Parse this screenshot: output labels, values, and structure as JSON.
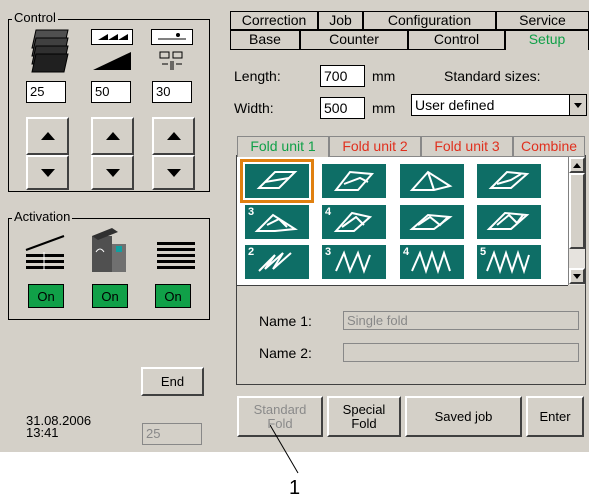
{
  "left": {
    "control_title": "Control",
    "values": [
      "25",
      "50",
      "30"
    ],
    "activation_title": "Activation",
    "on_labels": [
      "On",
      "On",
      "On"
    ],
    "end_label": "End",
    "date": "31.08.2006",
    "time": "13:41",
    "counter_value": "25"
  },
  "tabs": {
    "row1": [
      "Correction",
      "Job",
      "Configuration",
      "Service"
    ],
    "row2": [
      "Base",
      "Counter",
      "Control",
      "Setup"
    ],
    "active": "Setup",
    "active_color": "#10a048"
  },
  "sizes": {
    "length_label": "Length:",
    "length_value": "700",
    "width_label": "Width:",
    "width_value": "500",
    "unit": "mm",
    "standard_label": "Standard sizes:",
    "selected": "User defined"
  },
  "fold_tabs": {
    "items": [
      "Fold unit 1",
      "Fold unit 2",
      "Fold unit 3",
      "Combine"
    ],
    "active_color": "#10a048",
    "inactive_color": "#e0301e"
  },
  "fold_grid": {
    "badges": [
      "",
      "",
      "",
      "",
      "3",
      "4",
      "",
      "",
      "2",
      "3",
      "4",
      "5"
    ],
    "selected_index": 0,
    "tile_color": "#0e6e66",
    "selected_border": "#e08010"
  },
  "names": {
    "name1_label": "Name 1:",
    "name1_value": "Single fold",
    "name2_label": "Name 2:",
    "name2_value": ""
  },
  "bottom_buttons": {
    "standard_fold": [
      "Standard",
      "Fold"
    ],
    "special_fold": [
      "Special",
      "Fold"
    ],
    "saved_job": "Saved job",
    "enter": "Enter"
  },
  "callout": "1"
}
